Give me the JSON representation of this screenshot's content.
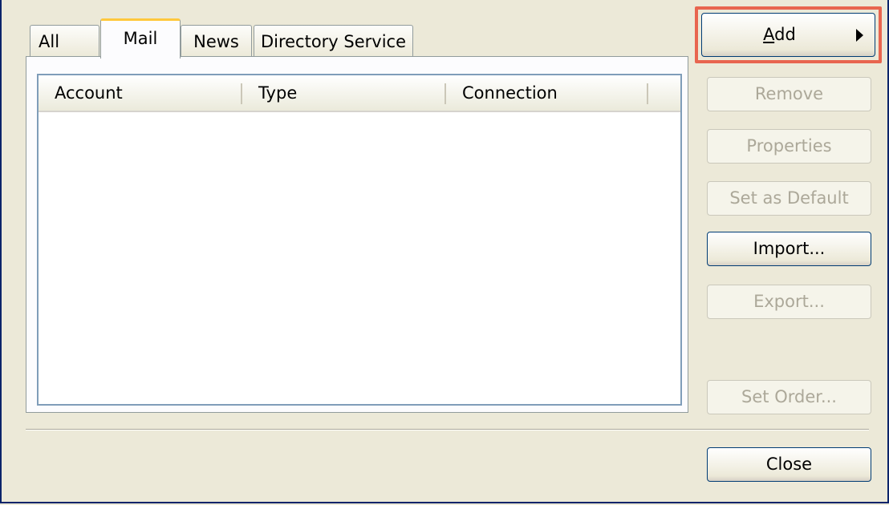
{
  "tabs": [
    {
      "label": "All",
      "selected": false
    },
    {
      "label": "Mail",
      "selected": true
    },
    {
      "label": "News",
      "selected": false
    },
    {
      "label": "Directory Service",
      "selected": false
    }
  ],
  "list": {
    "columns": [
      "Account",
      "Type",
      "Connection"
    ],
    "rows": []
  },
  "buttons": {
    "add": {
      "label_accel": "A",
      "label_rest": "dd",
      "enabled": true,
      "highlighted": true,
      "icon": "submenu-arrow-icon"
    },
    "remove": {
      "label": "Remove",
      "enabled": false
    },
    "properties": {
      "label": "Properties",
      "enabled": false
    },
    "set_default": {
      "label": "Set as Default",
      "enabled": false
    },
    "import": {
      "label": "Import...",
      "enabled": true
    },
    "export": {
      "label": "Export...",
      "enabled": false
    },
    "set_order": {
      "label": "Set Order...",
      "enabled": false
    },
    "close": {
      "label": "Close",
      "enabled": true
    }
  },
  "colors": {
    "highlight": "#e8654f",
    "selected_tab_accent": "#ffc83c",
    "window_bg": "#ece9d8"
  }
}
